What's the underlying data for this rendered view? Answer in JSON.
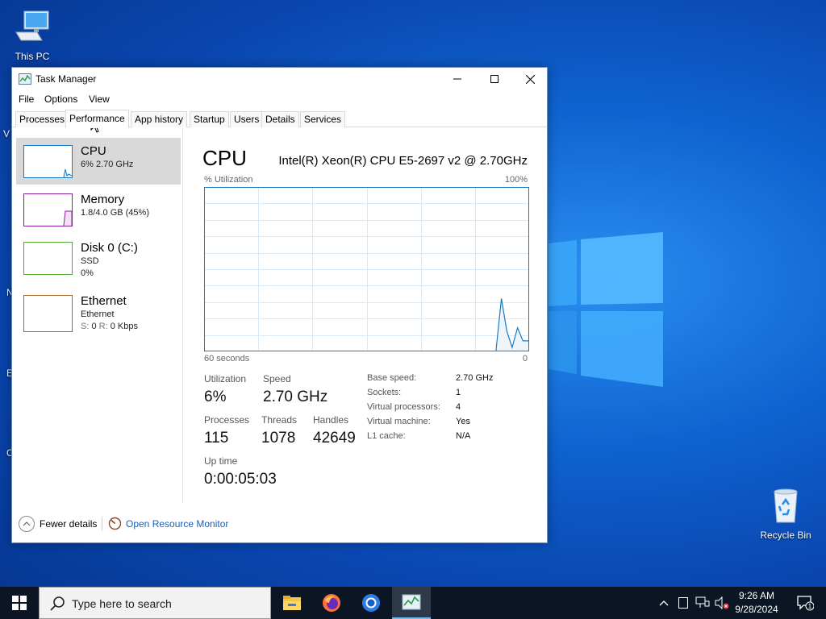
{
  "desktop": {
    "this_pc": "This PC",
    "recycle_bin": "Recycle Bin",
    "edge_letters": [
      "V",
      "N",
      "E",
      "C"
    ]
  },
  "window": {
    "title": "Task Manager",
    "menu": [
      "File",
      "Options",
      "View"
    ],
    "tabs": [
      "Processes",
      "Performance",
      "App history",
      "Startup",
      "Users",
      "Details",
      "Services"
    ],
    "active_tab": "Performance"
  },
  "sidebar": {
    "items": [
      {
        "name": "CPU",
        "sub1": "6% 2.70 GHz",
        "sub2": "",
        "color": "#1a7bc4"
      },
      {
        "name": "Memory",
        "sub1": "1.8/4.0 GB (45%)",
        "sub2": "",
        "color": "#8b1aa6"
      },
      {
        "name": "Disk 0 (C:)",
        "sub1": "SSD",
        "sub2": "0%",
        "color": "#4dab31"
      },
      {
        "name": "Ethernet",
        "sub1": "Ethernet",
        "sub2_s": "S:",
        "sub2_s_val": "0",
        "sub2_r": "R:",
        "sub2_r_val": "0 Kbps",
        "color": "#a7652a"
      }
    ]
  },
  "main": {
    "heading": "CPU",
    "model": "Intel(R) Xeon(R) CPU E5-2697 v2 @ 2.70GHz",
    "util_label": "% Utilization",
    "util_max": "100%",
    "time_span": "60 seconds",
    "time_zero": "0",
    "graph_color": "#1a7bc4",
    "graph_series": [
      0,
      0,
      0,
      0,
      0,
      0,
      0,
      0,
      0,
      0,
      0,
      0,
      0,
      0,
      0,
      0,
      0,
      0,
      0,
      0,
      0,
      0,
      0,
      0,
      0,
      0,
      0,
      0,
      0,
      0,
      0,
      0,
      0,
      0,
      0,
      0,
      0,
      0,
      0,
      0,
      0,
      0,
      0,
      0,
      0,
      0,
      0,
      0,
      0,
      0,
      0,
      0,
      0,
      0,
      0,
      32,
      12,
      2,
      14,
      6,
      6
    ],
    "stats": {
      "utilization_label": "Utilization",
      "utilization": "6%",
      "speed_label": "Speed",
      "speed": "2.70 GHz",
      "processes_label": "Processes",
      "processes": "115",
      "threads_label": "Threads",
      "threads": "1078",
      "handles_label": "Handles",
      "handles": "42649",
      "uptime_label": "Up time",
      "uptime": "0:00:05:03"
    },
    "specs": [
      {
        "label": "Base speed:",
        "value": "2.70 GHz"
      },
      {
        "label": "Sockets:",
        "value": "1"
      },
      {
        "label": "Virtual processors:",
        "value": "4"
      },
      {
        "label": "Virtual machine:",
        "value": "Yes"
      },
      {
        "label": "L1 cache:",
        "value": "N/A"
      }
    ]
  },
  "footer": {
    "fewer_details": "Fewer details",
    "open_resource_monitor": "Open Resource Monitor"
  },
  "taskbar": {
    "search_placeholder": "Type here to search",
    "time": "9:26 AM",
    "date": "9/28/2024",
    "notification_count": "1"
  }
}
